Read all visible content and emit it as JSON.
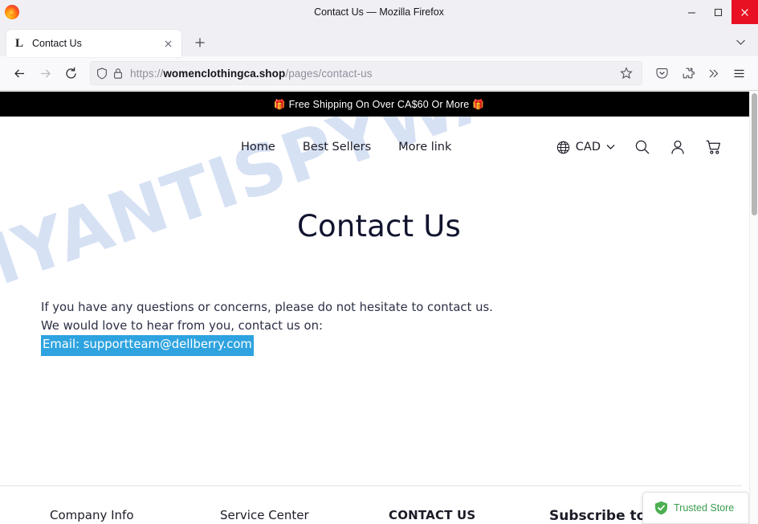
{
  "window": {
    "title": "Contact Us — Mozilla Firefox",
    "app_icon": "firefox-logo",
    "controls": {
      "minimize": "minimize-icon",
      "maximize": "maximize-icon",
      "close": "close-icon"
    }
  },
  "tabbar": {
    "tabs": [
      {
        "favicon_letter": "L",
        "label": "Contact Us",
        "close_label": "×"
      }
    ],
    "new_tab_label": "+",
    "list_all_tabs": "chevron-down-icon"
  },
  "toolbar": {
    "back": "back-arrow-icon",
    "forward": "forward-arrow-icon",
    "reload": "reload-icon",
    "shield": "shield-icon",
    "lock": "lock-icon",
    "url_scheme": "https://",
    "url_host": "womenclothingca.shop",
    "url_path": "/pages/contact-us",
    "bookmark": "star-icon",
    "pocket": "pocket-icon",
    "extensions": "puzzle-icon",
    "overflow": "double-chevron-icon",
    "app_menu": "hamburger-menu-icon"
  },
  "page": {
    "promo_banner": {
      "gift_left": "🎁",
      "text": "Free Shipping On Over CA$60 Or More",
      "gift_right": "🎁"
    },
    "watermark": "MYANTISPYWARE.COM",
    "header": {
      "nav": [
        {
          "label": "Home"
        },
        {
          "label": "Best Sellers"
        },
        {
          "label": "More link"
        }
      ],
      "currency": {
        "icon": "globe-icon",
        "value": "CAD",
        "chevron": "chevron-down-icon"
      },
      "actions": [
        {
          "name": "search-icon"
        },
        {
          "name": "account-icon"
        },
        {
          "name": "cart-icon"
        }
      ]
    },
    "title": "Contact Us",
    "body": {
      "line1": "If you have any questions or concerns, please do not hesitate to contact us.",
      "line2": "We would love to hear from you, contact us on:",
      "line3_selected": "Email: supportteam@dellberry.com"
    },
    "footer": {
      "col1": "Company Info",
      "col2": "Service Center",
      "col3": "CONTACT US",
      "col4": "Subscribe to"
    },
    "trusted_badge": {
      "icon": "shield-check-icon",
      "label": "Trusted Store"
    }
  },
  "colors": {
    "promo_bg": "#000000",
    "selection_blue": "#2ea3e0",
    "watermark_blue": "#c8d6f0",
    "trusted_green": "#3a9e4e",
    "close_red": "#e81123",
    "title_navy": "#11142e"
  }
}
